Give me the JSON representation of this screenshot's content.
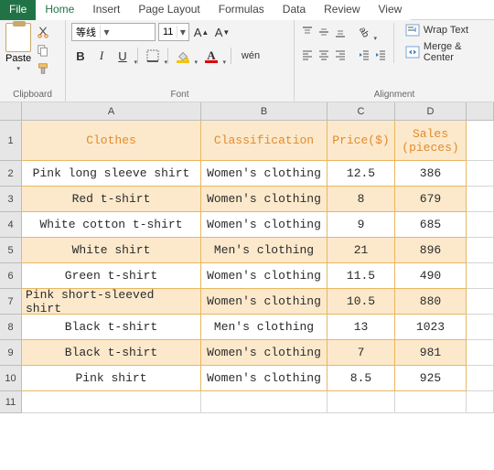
{
  "tabs": {
    "file": "File",
    "home": "Home",
    "insert": "Insert",
    "pagelayout": "Page Layout",
    "formulas": "Formulas",
    "data": "Data",
    "review": "Review",
    "view": "View"
  },
  "ribbon": {
    "clipboard": {
      "label": "Clipboard",
      "paste": "Paste"
    },
    "font": {
      "label": "Font",
      "name": "等线",
      "size": "11",
      "bold": "B",
      "italic": "I",
      "underline": "U"
    },
    "alignment": {
      "label": "Alignment",
      "wrap": "Wrap Text",
      "merge": "Merge & Center"
    }
  },
  "columns": [
    "A",
    "B",
    "C",
    "D"
  ],
  "rows": [
    "1",
    "2",
    "3",
    "4",
    "5",
    "6",
    "7",
    "8",
    "9",
    "10",
    "11"
  ],
  "headers": {
    "clothes": "Clothes",
    "classification": "Classification",
    "price": "Price($)",
    "sales": "Sales\n(pieces)"
  },
  "chart_data": {
    "type": "table",
    "columns": [
      "Clothes",
      "Classification",
      "Price($)",
      "Sales (pieces)"
    ],
    "rows": [
      {
        "clothes": "Pink long sleeve shirt",
        "classification": "Women's clothing",
        "price": 12.5,
        "sales": 386
      },
      {
        "clothes": "Red t-shirt",
        "classification": "Women's clothing",
        "price": 8,
        "sales": 679
      },
      {
        "clothes": "White cotton t-shirt",
        "classification": "Women's clothing",
        "price": 9,
        "sales": 685
      },
      {
        "clothes": "White shirt",
        "classification": "Men's clothing",
        "price": 21,
        "sales": 896
      },
      {
        "clothes": "Green t-shirt",
        "classification": "Women's clothing",
        "price": 11.5,
        "sales": 490
      },
      {
        "clothes": "Pink short-sleeved shirt",
        "classification": "Women's clothing",
        "price": 10.5,
        "sales": 880
      },
      {
        "clothes": "Black t-shirt",
        "classification": "Men's clothing",
        "price": 13,
        "sales": 1023
      },
      {
        "clothes": "Black t-shirt",
        "classification": "Women's clothing",
        "price": 7,
        "sales": 981
      },
      {
        "clothes": "Pink shirt",
        "classification": "Women's clothing",
        "price": 8.5,
        "sales": 925
      }
    ]
  }
}
